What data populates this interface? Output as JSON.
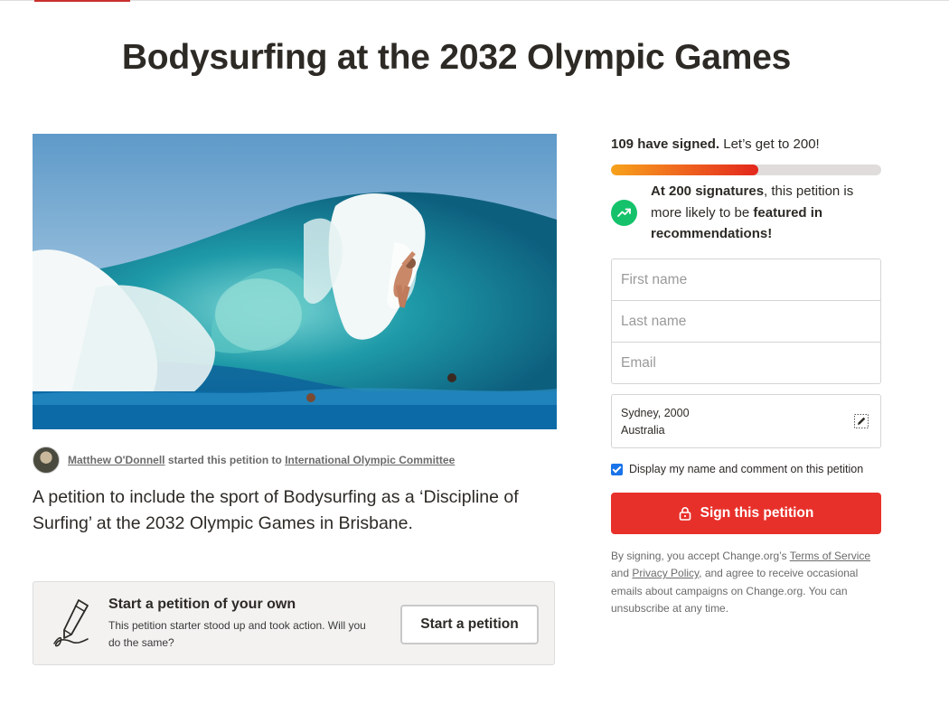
{
  "page": {
    "title": "Bodysurfing at the 2032 Olympic Games",
    "description": "A petition to include the sport of Bodysurfing as a ‘Discipline of Surfing’ at the 2032 Olympic Games in Brisbane."
  },
  "starter": {
    "name": "Matthew O'Donnell",
    "middle_text": " started this petition to ",
    "target": "International Olympic Committee"
  },
  "start_box": {
    "title": "Start a petition of your own",
    "subtitle": "This petition starter stood up and took action. Will you do the same?",
    "button": "Start a petition"
  },
  "progress": {
    "signed_label": "109 have signed.",
    "goal_label": " Let’s get to 200!",
    "signed": 109,
    "goal": 200
  },
  "goal_message": {
    "part1_bold": "At 200 signatures",
    "part2": ", this petition is more likely to be ",
    "part3_bold": "featured in recommendations!"
  },
  "form": {
    "first_name_placeholder": "First name",
    "last_name_placeholder": "Last name",
    "email_placeholder": "Email",
    "location_line1": "Sydney, 2000",
    "location_line2": "Australia",
    "display_label": "Display my name and comment on this petition",
    "display_checked": true,
    "sign_button": "Sign this petition"
  },
  "legal": {
    "prefix": "By signing, you accept Change.org’s ",
    "terms": "Terms of Service",
    "and": " and ",
    "privacy": "Privacy Policy",
    "suffix": ", and agree to receive occasional emails about campaigns on Change.org. You can unsubscribe at any time."
  },
  "colors": {
    "sign_button": "#e8302a",
    "goal_icon": "#15c26b",
    "progress_start": "#f7a21b",
    "progress_end": "#e3271c"
  },
  "icons": [
    "trending-up-icon",
    "edit-icon",
    "lock-icon",
    "pen-signature-icon"
  ]
}
